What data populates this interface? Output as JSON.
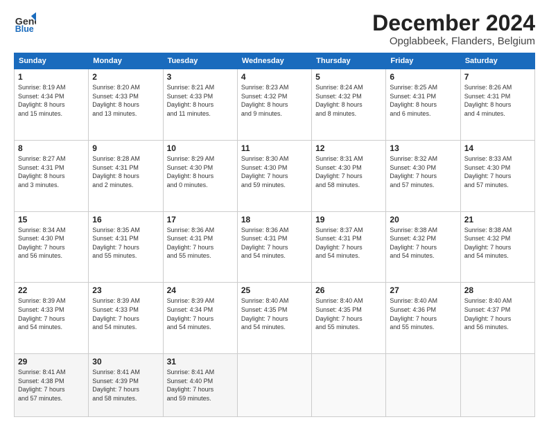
{
  "header": {
    "logo_line1": "General",
    "logo_line2": "Blue",
    "title": "December 2024",
    "subtitle": "Opglabbeek, Flanders, Belgium"
  },
  "weekdays": [
    "Sunday",
    "Monday",
    "Tuesday",
    "Wednesday",
    "Thursday",
    "Friday",
    "Saturday"
  ],
  "weeks": [
    [
      {
        "day": "1",
        "info": "Sunrise: 8:19 AM\nSunset: 4:34 PM\nDaylight: 8 hours\nand 15 minutes."
      },
      {
        "day": "2",
        "info": "Sunrise: 8:20 AM\nSunset: 4:33 PM\nDaylight: 8 hours\nand 13 minutes."
      },
      {
        "day": "3",
        "info": "Sunrise: 8:21 AM\nSunset: 4:33 PM\nDaylight: 8 hours\nand 11 minutes."
      },
      {
        "day": "4",
        "info": "Sunrise: 8:23 AM\nSunset: 4:32 PM\nDaylight: 8 hours\nand 9 minutes."
      },
      {
        "day": "5",
        "info": "Sunrise: 8:24 AM\nSunset: 4:32 PM\nDaylight: 8 hours\nand 8 minutes."
      },
      {
        "day": "6",
        "info": "Sunrise: 8:25 AM\nSunset: 4:31 PM\nDaylight: 8 hours\nand 6 minutes."
      },
      {
        "day": "7",
        "info": "Sunrise: 8:26 AM\nSunset: 4:31 PM\nDaylight: 8 hours\nand 4 minutes."
      }
    ],
    [
      {
        "day": "8",
        "info": "Sunrise: 8:27 AM\nSunset: 4:31 PM\nDaylight: 8 hours\nand 3 minutes."
      },
      {
        "day": "9",
        "info": "Sunrise: 8:28 AM\nSunset: 4:31 PM\nDaylight: 8 hours\nand 2 minutes."
      },
      {
        "day": "10",
        "info": "Sunrise: 8:29 AM\nSunset: 4:30 PM\nDaylight: 8 hours\nand 0 minutes."
      },
      {
        "day": "11",
        "info": "Sunrise: 8:30 AM\nSunset: 4:30 PM\nDaylight: 7 hours\nand 59 minutes."
      },
      {
        "day": "12",
        "info": "Sunrise: 8:31 AM\nSunset: 4:30 PM\nDaylight: 7 hours\nand 58 minutes."
      },
      {
        "day": "13",
        "info": "Sunrise: 8:32 AM\nSunset: 4:30 PM\nDaylight: 7 hours\nand 57 minutes."
      },
      {
        "day": "14",
        "info": "Sunrise: 8:33 AM\nSunset: 4:30 PM\nDaylight: 7 hours\nand 57 minutes."
      }
    ],
    [
      {
        "day": "15",
        "info": "Sunrise: 8:34 AM\nSunset: 4:30 PM\nDaylight: 7 hours\nand 56 minutes."
      },
      {
        "day": "16",
        "info": "Sunrise: 8:35 AM\nSunset: 4:31 PM\nDaylight: 7 hours\nand 55 minutes."
      },
      {
        "day": "17",
        "info": "Sunrise: 8:36 AM\nSunset: 4:31 PM\nDaylight: 7 hours\nand 55 minutes."
      },
      {
        "day": "18",
        "info": "Sunrise: 8:36 AM\nSunset: 4:31 PM\nDaylight: 7 hours\nand 54 minutes."
      },
      {
        "day": "19",
        "info": "Sunrise: 8:37 AM\nSunset: 4:31 PM\nDaylight: 7 hours\nand 54 minutes."
      },
      {
        "day": "20",
        "info": "Sunrise: 8:38 AM\nSunset: 4:32 PM\nDaylight: 7 hours\nand 54 minutes."
      },
      {
        "day": "21",
        "info": "Sunrise: 8:38 AM\nSunset: 4:32 PM\nDaylight: 7 hours\nand 54 minutes."
      }
    ],
    [
      {
        "day": "22",
        "info": "Sunrise: 8:39 AM\nSunset: 4:33 PM\nDaylight: 7 hours\nand 54 minutes."
      },
      {
        "day": "23",
        "info": "Sunrise: 8:39 AM\nSunset: 4:33 PM\nDaylight: 7 hours\nand 54 minutes."
      },
      {
        "day": "24",
        "info": "Sunrise: 8:39 AM\nSunset: 4:34 PM\nDaylight: 7 hours\nand 54 minutes."
      },
      {
        "day": "25",
        "info": "Sunrise: 8:40 AM\nSunset: 4:35 PM\nDaylight: 7 hours\nand 54 minutes."
      },
      {
        "day": "26",
        "info": "Sunrise: 8:40 AM\nSunset: 4:35 PM\nDaylight: 7 hours\nand 55 minutes."
      },
      {
        "day": "27",
        "info": "Sunrise: 8:40 AM\nSunset: 4:36 PM\nDaylight: 7 hours\nand 55 minutes."
      },
      {
        "day": "28",
        "info": "Sunrise: 8:40 AM\nSunset: 4:37 PM\nDaylight: 7 hours\nand 56 minutes."
      }
    ],
    [
      {
        "day": "29",
        "info": "Sunrise: 8:41 AM\nSunset: 4:38 PM\nDaylight: 7 hours\nand 57 minutes."
      },
      {
        "day": "30",
        "info": "Sunrise: 8:41 AM\nSunset: 4:39 PM\nDaylight: 7 hours\nand 58 minutes."
      },
      {
        "day": "31",
        "info": "Sunrise: 8:41 AM\nSunset: 4:40 PM\nDaylight: 7 hours\nand 59 minutes."
      },
      {
        "day": "",
        "info": ""
      },
      {
        "day": "",
        "info": ""
      },
      {
        "day": "",
        "info": ""
      },
      {
        "day": "",
        "info": ""
      }
    ]
  ]
}
